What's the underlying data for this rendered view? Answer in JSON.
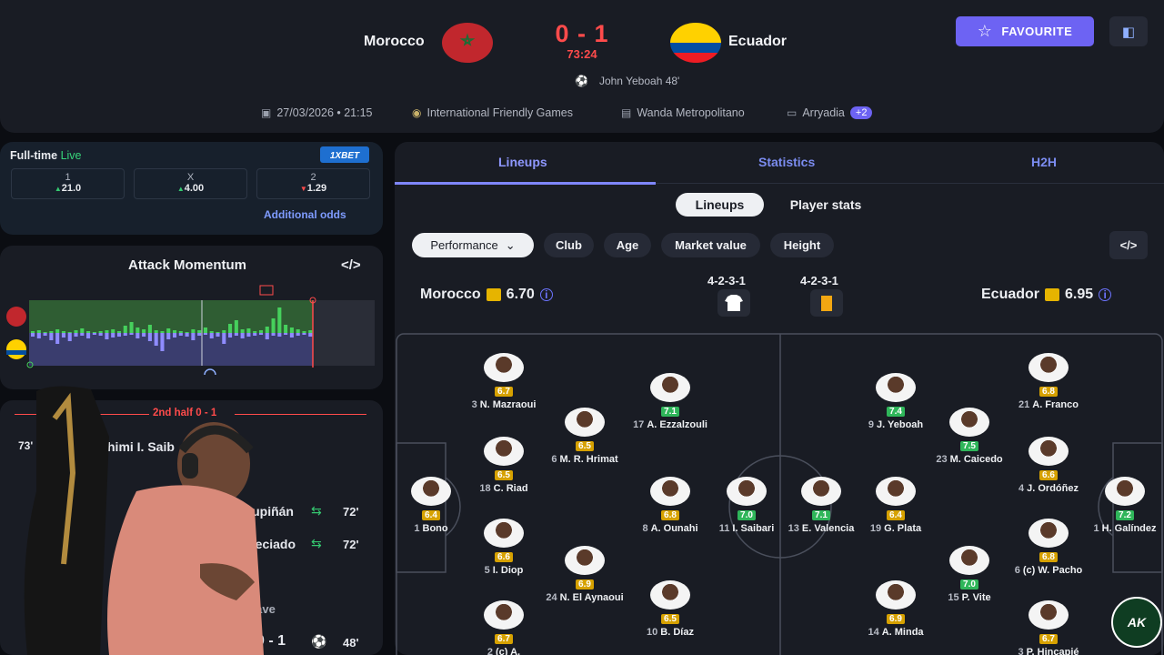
{
  "header": {
    "home_team": "Morocco",
    "away_team": "Ecuador",
    "score": "0 - 1",
    "clock": "73:24",
    "goal_event": "John Yeboah 48'",
    "date": "27/03/2026 • 21:15",
    "competition": "International Friendly Games",
    "venue": "Wanda Metropolitano",
    "referee": "Arryadia",
    "more_badge": "+2",
    "favourite_label": "FAVOURITE",
    "colors": {
      "home": "#c1272d",
      "away": "#ffd100",
      "accent": "#6d63f3",
      "score": "#ff4b4b"
    }
  },
  "odds": {
    "title": "Full-time",
    "live_label": "Live",
    "bookmaker": "1XBET",
    "markets": [
      {
        "label": "1",
        "value": "21.0",
        "trend": "up"
      },
      {
        "label": "X",
        "value": "4.00",
        "trend": "up"
      },
      {
        "label": "2",
        "value": "1.29",
        "trend": "down"
      }
    ],
    "additional": "Additional odds"
  },
  "momentum": {
    "title": "Attack Momentum",
    "code_icon": "</>",
    "home_bars": [
      2,
      3,
      1,
      2,
      4,
      2,
      1,
      3,
      5,
      2,
      1,
      2,
      3,
      4,
      2,
      8,
      12,
      6,
      4,
      9,
      3,
      2,
      5,
      3,
      2,
      1,
      4,
      3,
      6,
      2,
      1,
      3,
      10,
      14,
      4,
      5,
      2,
      3,
      7,
      16,
      28,
      9,
      6,
      4,
      2,
      3
    ],
    "away_bars": [
      4,
      6,
      3,
      8,
      12,
      5,
      9,
      4,
      3,
      6,
      2,
      3,
      7,
      5,
      4,
      3,
      2,
      6,
      4,
      9,
      14,
      20,
      7,
      5,
      3,
      4,
      8,
      3,
      2,
      6,
      4,
      12,
      5,
      3,
      6,
      4,
      3,
      2,
      7,
      3,
      4,
      2,
      5,
      3,
      2,
      4
    ]
  },
  "events": {
    "half_title": "2nd half 0 - 1",
    "rows": [
      {
        "minute": "73'",
        "text": "himi  I. Saib"
      },
      {
        "text": "P. Estupiñán",
        "minute": "72'"
      },
      {
        "text": "A. Preciado",
        "minute": "72'"
      },
      {
        "text": "hat"
      },
      {
        "text": "er save"
      },
      {
        "text": "0 - 1",
        "minute": "48'"
      }
    ]
  },
  "lineup": {
    "tabs": [
      "Lineups",
      "Statistics",
      "H2H"
    ],
    "segments": [
      "Lineups",
      "Player stats"
    ],
    "filters": [
      "Performance",
      "Club",
      "Age",
      "Market value",
      "Height"
    ],
    "code_icon": "</>",
    "home": {
      "name": "Morocco",
      "rating": "6.70",
      "formation": "4-2-3-1"
    },
    "away": {
      "name": "Ecuador",
      "rating": "6.95",
      "formation": "4-2-3-1"
    },
    "home_players": [
      {
        "name": "Bono",
        "number": "1",
        "rating": "6.4",
        "color": "y"
      },
      {
        "name": "N. Mazraoui",
        "number": "3",
        "rating": "6.7",
        "color": "y"
      },
      {
        "name": "C. Riad",
        "number": "18",
        "rating": "6.5",
        "color": "y"
      },
      {
        "name": "I. Diop",
        "number": "5",
        "rating": "6.6",
        "color": "y"
      },
      {
        "name": "(c) A.",
        "number": "2",
        "rating": "6.7",
        "color": "y"
      },
      {
        "name": "M. R. Hrimat",
        "number": "6",
        "rating": "6.5",
        "color": "y"
      },
      {
        "name": "N. El Aynaoui",
        "number": "24",
        "rating": "6.9",
        "color": "y"
      },
      {
        "name": "A. Ezzalzouli",
        "number": "17",
        "rating": "7.1",
        "color": "g"
      },
      {
        "name": "A. Ounahi",
        "number": "8",
        "rating": "6.8",
        "color": "y"
      },
      {
        "name": "B. Díaz",
        "number": "10",
        "rating": "6.5",
        "color": "y"
      },
      {
        "name": "I. Saibari",
        "number": "11",
        "rating": "7.0",
        "color": "g"
      }
    ],
    "away_players": [
      {
        "name": "E. Valencia",
        "number": "13",
        "rating": "7.1",
        "color": "g"
      },
      {
        "name": "J. Yeboah",
        "number": "9",
        "rating": "7.4",
        "color": "g"
      },
      {
        "name": "G. Plata",
        "number": "19",
        "rating": "6.4",
        "color": "y"
      },
      {
        "name": "A. Minda",
        "number": "14",
        "rating": "6.9",
        "color": "y"
      },
      {
        "name": "M. Caicedo",
        "number": "23",
        "rating": "7.5",
        "color": "g"
      },
      {
        "name": "P. Vite",
        "number": "15",
        "rating": "7.0",
        "color": "g"
      },
      {
        "name": "A. Franco",
        "number": "21",
        "rating": "6.8",
        "color": "y"
      },
      {
        "name": "J. Ordóñez",
        "number": "4",
        "rating": "6.6",
        "color": "y"
      },
      {
        "name": "(c) W. Pacho",
        "number": "6",
        "rating": "6.8",
        "color": "y"
      },
      {
        "name": "P. Hincapié",
        "number": "3",
        "rating": "6.7",
        "color": "y"
      },
      {
        "name": "H. Galíndez",
        "number": "1",
        "rating": "7.2",
        "color": "g"
      }
    ]
  },
  "watermark": "AK"
}
